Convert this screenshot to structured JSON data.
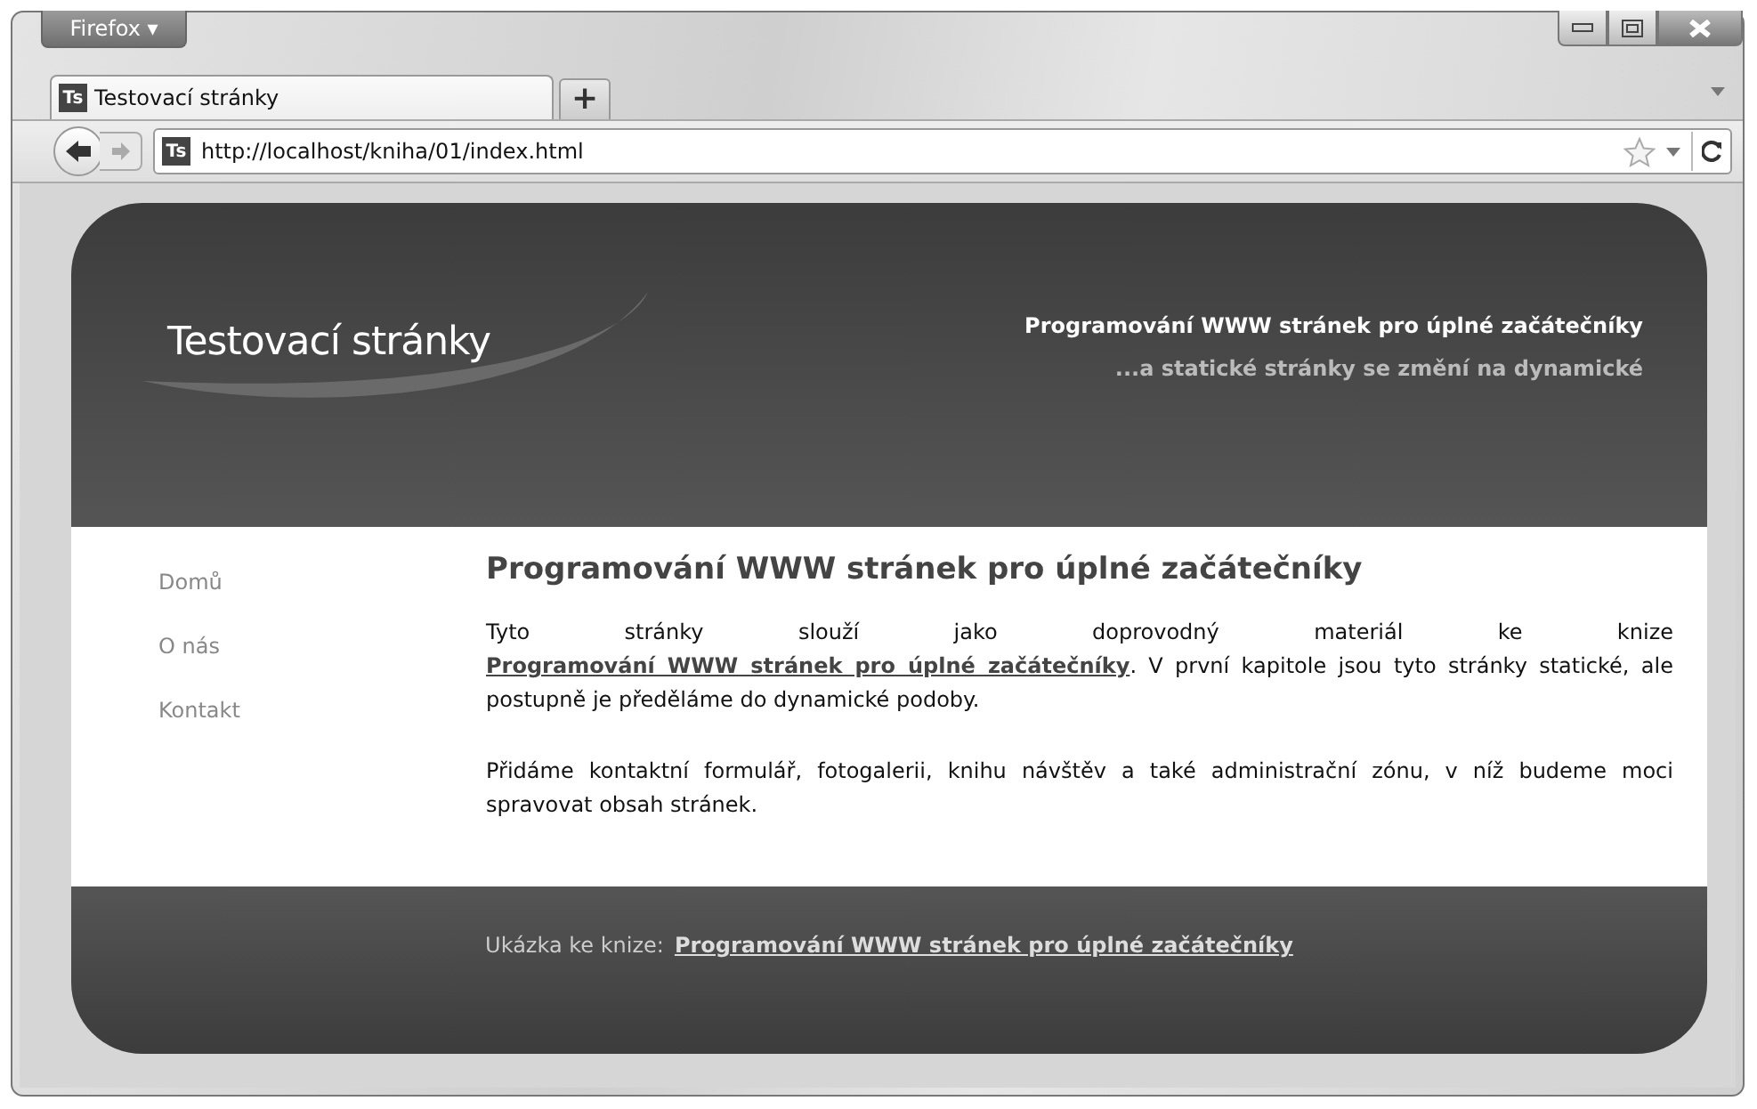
{
  "browser": {
    "menu_button": "Firefox ▾",
    "tabs": [
      {
        "title": "Testovací stránky",
        "favicon": "Ts",
        "selected": true
      }
    ],
    "new_tab": "+",
    "url": "http://localhost/kniha/01/index.html",
    "url_favicon": "Ts"
  },
  "page": {
    "header": {
      "logo": "Testovací stránky",
      "tagline": "Programování WWW stránek pro úplné začátečníky",
      "subtagline": "...a statické stránky se změní na dynamické"
    },
    "nav": [
      {
        "label": "Domů"
      },
      {
        "label": "O nás"
      },
      {
        "label": "Kontakt"
      }
    ],
    "heading": "Programování WWW stránek pro úplné začátečníky",
    "paragraphs": [
      {
        "before": "Tyto stránky slouží jako doprovodný materiál ke knize ",
        "link": "Programování WWW stránek pro úplné začátečníky",
        "after": ". V první kapitole jsou tyto stránky statické, ale postupně je předěláme do dynamické podoby."
      },
      {
        "before": "Přidáme kontaktní formulář, fotogalerii, knihu návštěv a také administrační zónu, v níž budeme moci spravovat obsah stránek."
      }
    ],
    "footer": {
      "label": "Ukázka ke knize:",
      "link": "Programování WWW stránek pro úplné začátečníky"
    }
  }
}
